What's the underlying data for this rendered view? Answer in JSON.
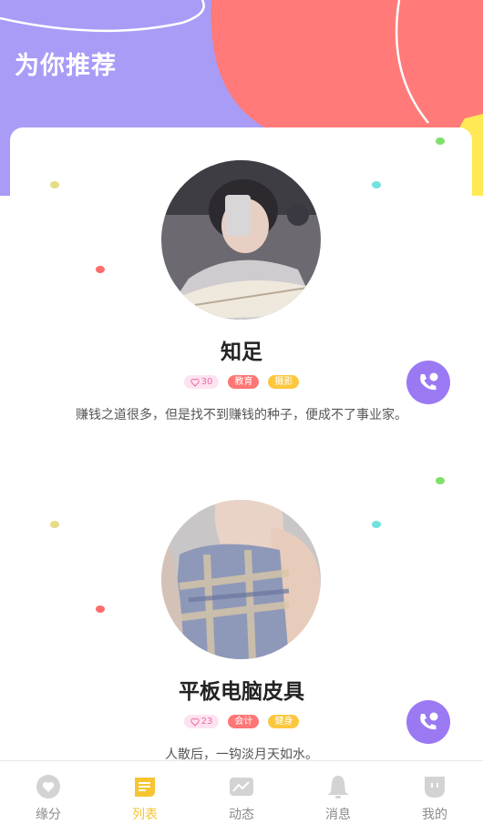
{
  "header": {
    "title": "为你推荐"
  },
  "colors": {
    "purple": "#a89cf7",
    "coral": "#ff7a78",
    "yellow": "#ffe955",
    "call_button": "#9a79f3",
    "tab_active": "#f6c531",
    "tab_inactive": "#cfcfcf"
  },
  "users": [
    {
      "name": "知足",
      "likes": "30",
      "tags": [
        "教育",
        "摄影"
      ],
      "bio": "赚钱之道很多，但是找不到赚钱的种子，便成不了事业家。",
      "call_icon": "phone-call-icon"
    },
    {
      "name": "平板电脑皮具",
      "likes": "23",
      "tags": [
        "会计",
        "健身"
      ],
      "bio": "人散后，一钩淡月天如水。",
      "call_icon": "phone-call-icon"
    }
  ],
  "tab_bar": {
    "active_index": 1,
    "items": [
      {
        "label": "缘分",
        "icon": "heart-icon"
      },
      {
        "label": "列表",
        "icon": "list-icon"
      },
      {
        "label": "动态",
        "icon": "trend-icon"
      },
      {
        "label": "消息",
        "icon": "bell-icon"
      },
      {
        "label": "我的",
        "icon": "profile-icon"
      }
    ]
  }
}
